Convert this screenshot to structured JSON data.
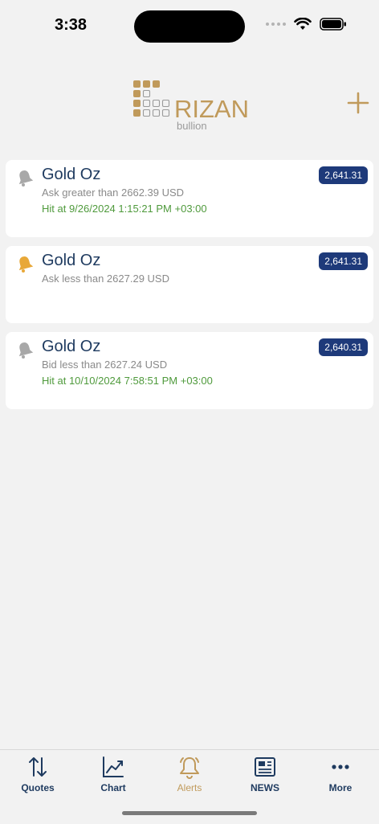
{
  "status_bar": {
    "time": "3:38"
  },
  "header": {
    "logo_text": "RIZAN",
    "logo_subtext": "bullion",
    "add_icon": "plus-icon",
    "brand_color": "#c09a5b"
  },
  "alerts": [
    {
      "title": "Gold Oz",
      "condition": "Ask greater than 2662.39 USD",
      "hit": "Hit at 9/26/2024 1:15:21 PM +03:00",
      "price": "2,641.31",
      "bell_state": "inactive"
    },
    {
      "title": "Gold Oz",
      "condition": "Ask less than 2627.29 USD",
      "hit": "",
      "price": "2,641.31",
      "bell_state": "active"
    },
    {
      "title": "Gold Oz",
      "condition": "Bid less than 2627.24 USD",
      "hit": "Hit at 10/10/2024 7:58:51 PM +03:00",
      "price": "2,640.31",
      "bell_state": "inactive"
    }
  ],
  "tabs": [
    {
      "label": "Quotes",
      "icon": "sort-arrows-icon",
      "active": false
    },
    {
      "label": "Chart",
      "icon": "chart-icon",
      "active": false
    },
    {
      "label": "Alerts",
      "icon": "bell-icon",
      "active": true
    },
    {
      "label": "NEWS",
      "icon": "newspaper-icon",
      "active": false
    },
    {
      "label": "More",
      "icon": "more-dots-icon",
      "active": false
    }
  ],
  "colors": {
    "navy": "#1e3a5f",
    "badge": "#1e3a7a",
    "hit_green": "#4f9a3c",
    "bell_active": "#e8a838",
    "bell_inactive": "#a8a8a8"
  }
}
